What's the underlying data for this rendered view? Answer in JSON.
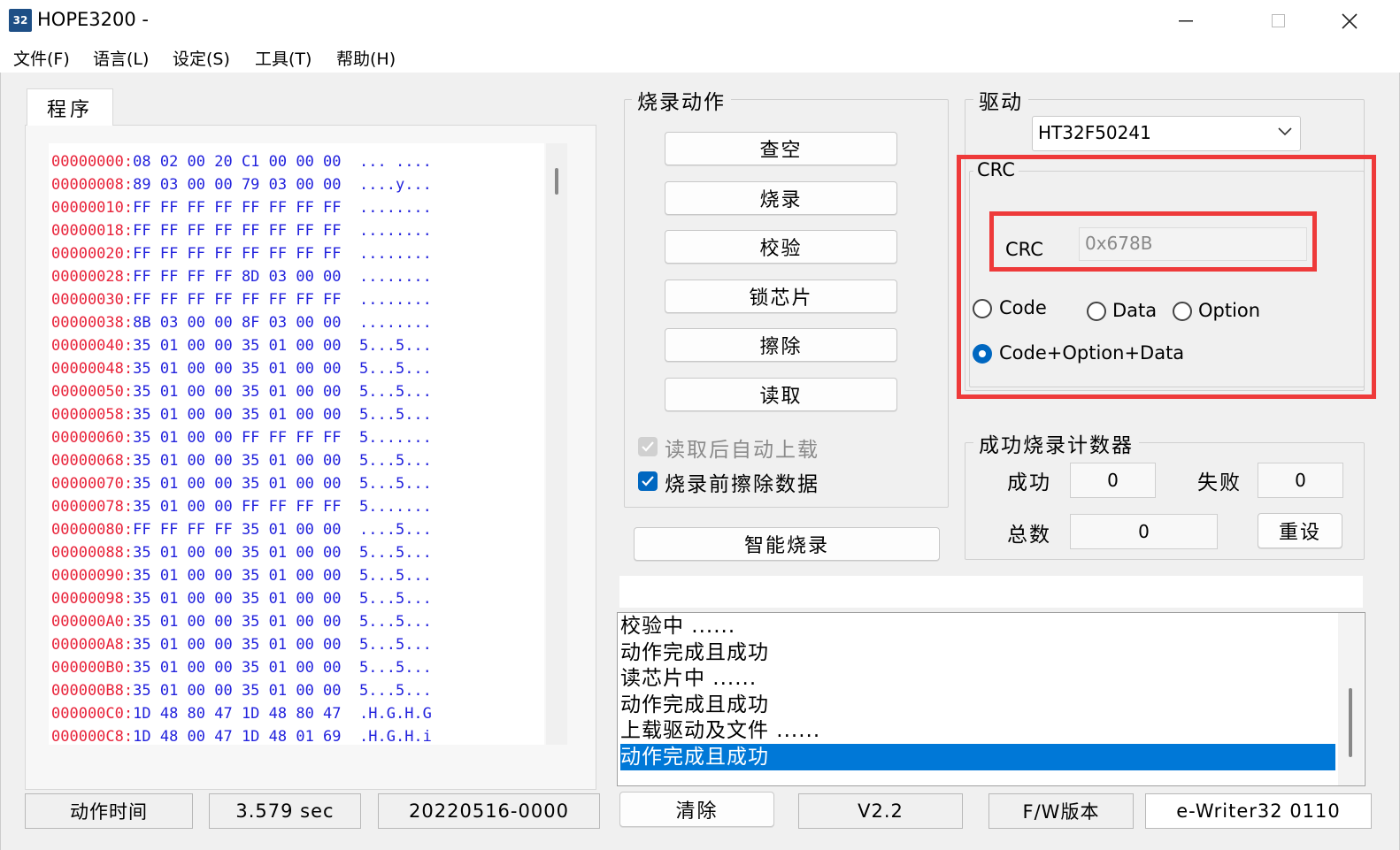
{
  "window": {
    "title": "HOPE3200  -",
    "icon_text": "32"
  },
  "menu": [
    {
      "label": "文件(F)"
    },
    {
      "label": "语言(L)"
    },
    {
      "label": "设定(S)"
    },
    {
      "label": "工具(T)"
    },
    {
      "label": "帮助(H)"
    }
  ],
  "program": {
    "tab_label": "程序",
    "hex_rows": [
      {
        "addr": "00000000:",
        "bytes": "08 02 00 20 C1 00 00 00",
        "ascii": "... ...."
      },
      {
        "addr": "00000008:",
        "bytes": "89 03 00 00 79 03 00 00",
        "ascii": "....y..."
      },
      {
        "addr": "00000010:",
        "bytes": "FF FF FF FF FF FF FF FF",
        "ascii": "........"
      },
      {
        "addr": "00000018:",
        "bytes": "FF FF FF FF FF FF FF FF",
        "ascii": "........"
      },
      {
        "addr": "00000020:",
        "bytes": "FF FF FF FF FF FF FF FF",
        "ascii": "........"
      },
      {
        "addr": "00000028:",
        "bytes": "FF FF FF FF 8D 03 00 00",
        "ascii": "........"
      },
      {
        "addr": "00000030:",
        "bytes": "FF FF FF FF FF FF FF FF",
        "ascii": "........"
      },
      {
        "addr": "00000038:",
        "bytes": "8B 03 00 00 8F 03 00 00",
        "ascii": "........"
      },
      {
        "addr": "00000040:",
        "bytes": "35 01 00 00 35 01 00 00",
        "ascii": "5...5..."
      },
      {
        "addr": "00000048:",
        "bytes": "35 01 00 00 35 01 00 00",
        "ascii": "5...5..."
      },
      {
        "addr": "00000050:",
        "bytes": "35 01 00 00 35 01 00 00",
        "ascii": "5...5..."
      },
      {
        "addr": "00000058:",
        "bytes": "35 01 00 00 35 01 00 00",
        "ascii": "5...5..."
      },
      {
        "addr": "00000060:",
        "bytes": "35 01 00 00 FF FF FF FF",
        "ascii": "5......."
      },
      {
        "addr": "00000068:",
        "bytes": "35 01 00 00 35 01 00 00",
        "ascii": "5...5..."
      },
      {
        "addr": "00000070:",
        "bytes": "35 01 00 00 35 01 00 00",
        "ascii": "5...5..."
      },
      {
        "addr": "00000078:",
        "bytes": "35 01 00 00 FF FF FF FF",
        "ascii": "5......."
      },
      {
        "addr": "00000080:",
        "bytes": "FF FF FF FF 35 01 00 00",
        "ascii": "....5..."
      },
      {
        "addr": "00000088:",
        "bytes": "35 01 00 00 35 01 00 00",
        "ascii": "5...5..."
      },
      {
        "addr": "00000090:",
        "bytes": "35 01 00 00 35 01 00 00",
        "ascii": "5...5..."
      },
      {
        "addr": "00000098:",
        "bytes": "35 01 00 00 35 01 00 00",
        "ascii": "5...5..."
      },
      {
        "addr": "000000A0:",
        "bytes": "35 01 00 00 35 01 00 00",
        "ascii": "5...5..."
      },
      {
        "addr": "000000A8:",
        "bytes": "35 01 00 00 35 01 00 00",
        "ascii": "5...5..."
      },
      {
        "addr": "000000B0:",
        "bytes": "35 01 00 00 35 01 00 00",
        "ascii": "5...5..."
      },
      {
        "addr": "000000B8:",
        "bytes": "35 01 00 00 35 01 00 00",
        "ascii": "5...5..."
      },
      {
        "addr": "000000C0:",
        "bytes": "1D 48 80 47 1D 48 80 47",
        "ascii": ".H.G.H.G"
      },
      {
        "addr": "000000C8:",
        "bytes": "1D 48 00 47 1D 48 01 69",
        "ascii": ".H.G.H.i"
      }
    ]
  },
  "actions": {
    "title": "烧录动作",
    "buttons": [
      "查空",
      "烧录",
      "校验",
      "锁芯片",
      "擦除",
      "读取"
    ],
    "auto_upload_label": "读取后自动上载",
    "auto_upload_checked": true,
    "auto_upload_disabled": true,
    "erase_before_label": "烧录前擦除数据",
    "erase_before_checked": true,
    "smart_burn_label": "智能烧录"
  },
  "driver": {
    "title": "驱动",
    "selected": "HT32F50241"
  },
  "crc": {
    "group_title": "CRC",
    "field_label": "CRC",
    "value": "0x678B",
    "options": [
      {
        "label": "Code",
        "checked": false
      },
      {
        "label": "Data",
        "checked": false
      },
      {
        "label": "Option",
        "checked": false
      },
      {
        "label": "Code+Option+Data",
        "checked": true
      }
    ],
    "highlight_color": "#ee3a3a"
  },
  "counter": {
    "title": "成功烧录计数器",
    "success_label": "成功",
    "success_value": "0",
    "fail_label": "失败",
    "fail_value": "0",
    "total_label": "总数",
    "total_value": "0",
    "reset_label": "重设"
  },
  "log": {
    "lines": [
      {
        "text": "校验中 ......",
        "selected": false
      },
      {
        "text": "动作完成且成功",
        "selected": false
      },
      {
        "text": "读芯片中 ......",
        "selected": false
      },
      {
        "text": "动作完成且成功",
        "selected": false
      },
      {
        "text": "上载驱动及文件 ......",
        "selected": false
      },
      {
        "text": "动作完成且成功",
        "selected": true
      }
    ],
    "selection_color": "#0078d7"
  },
  "statusbar": {
    "action_time_label": "动作时间",
    "action_time_value": "3.579 sec",
    "build": "20220516-0000",
    "clear_label": "清除",
    "version": "V2.2",
    "fw_label": "F/W版本",
    "fw_value": "e-Writer32 0110"
  }
}
